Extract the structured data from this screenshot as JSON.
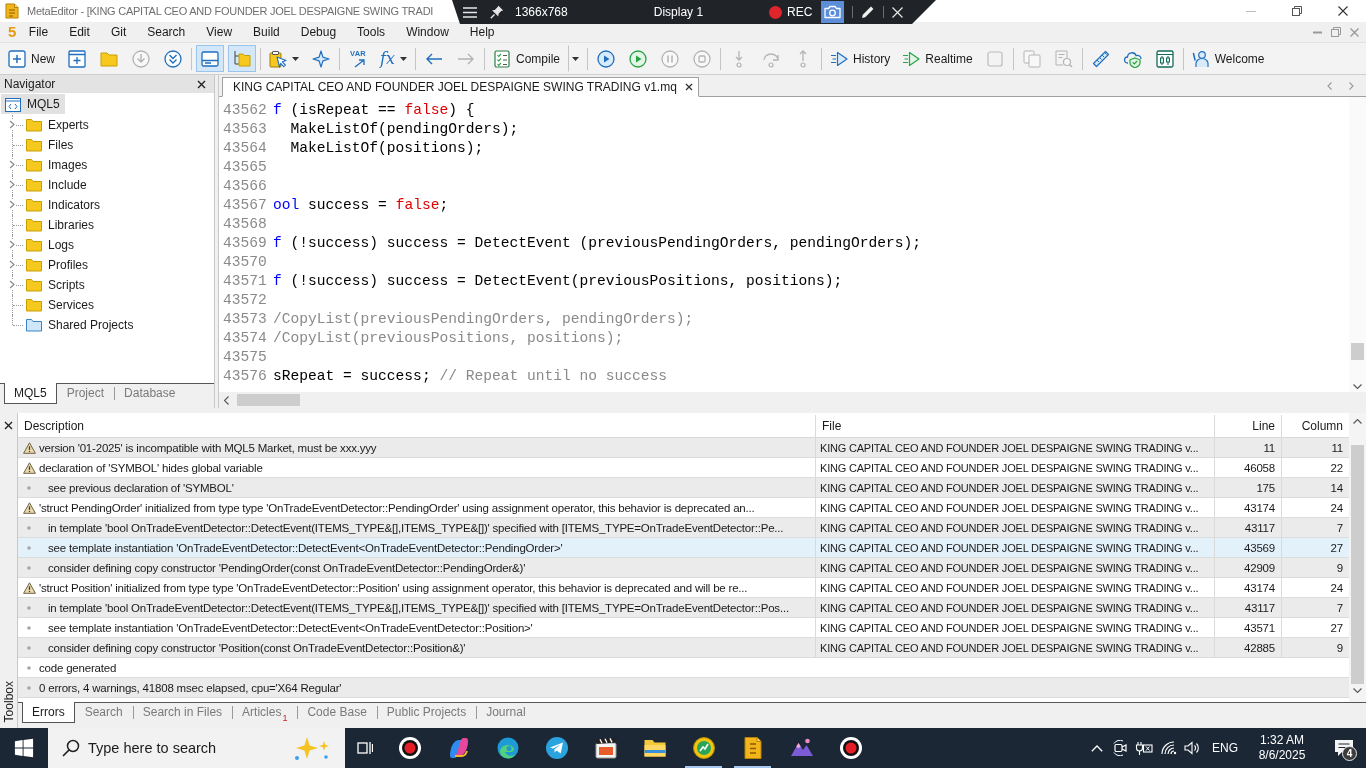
{
  "window": {
    "title": "MetaEditor - [KING CAPITAL CEO AND FOUNDER JOEL DESPAIGNE SWING TRADI"
  },
  "recorder": {
    "resolution": "1366x768",
    "display": "Display 1",
    "status": "REC",
    "camera": {
      "selected": true
    }
  },
  "menu": {
    "logo": "5",
    "items": [
      "File",
      "Edit",
      "Git",
      "Search",
      "View",
      "Build",
      "Debug",
      "Tools",
      "Window",
      "Help"
    ]
  },
  "toolbar": [
    {
      "kind": "icon",
      "label": "New",
      "disabled": false,
      "selected": false,
      "dropdown": false
    },
    {
      "kind": "icon",
      "disabled": false,
      "selected": false,
      "dropdown": false
    },
    {
      "kind": "icon",
      "disabled": false,
      "selected": false,
      "dropdown": false
    },
    {
      "kind": "icon",
      "disabled": true,
      "selected": false,
      "dropdown": false
    },
    {
      "kind": "icon",
      "disabled": false,
      "selected": false,
      "dropdown": false
    },
    {
      "kind": "separator"
    },
    {
      "kind": "icon",
      "disabled": false,
      "selected": true,
      "dropdown": false
    },
    {
      "kind": "icon",
      "disabled": false,
      "selected": true,
      "dropdown": false
    },
    {
      "kind": "separator"
    },
    {
      "kind": "icon",
      "disabled": false,
      "selected": false,
      "dropdown": true
    },
    {
      "kind": "icon",
      "disabled": false,
      "selected": false,
      "dropdown": false
    },
    {
      "kind": "separator"
    },
    {
      "kind": "tag",
      "label": "VAR",
      "disabled": false,
      "selected": false,
      "dropdown": false
    },
    {
      "kind": "formula",
      "label": "fx",
      "disabled": false,
      "selected": false,
      "dropdown": true
    },
    {
      "kind": "separator"
    },
    {
      "kind": "icon",
      "disabled": false,
      "selected": false,
      "dropdown": false
    },
    {
      "kind": "icon",
      "disabled": true,
      "selected": false,
      "dropdown": false
    },
    {
      "kind": "separator"
    },
    {
      "kind": "icon",
      "label": "Compile",
      "disabled": false,
      "selected": false,
      "dropdown": false
    },
    {
      "kind": "caret",
      "disabled": false,
      "selected": false
    },
    {
      "kind": "separator"
    },
    {
      "kind": "icon",
      "disabled": false,
      "selected": false,
      "dropdown": false
    },
    {
      "kind": "icon",
      "disabled": false,
      "selected": false,
      "dropdown": false
    },
    {
      "kind": "icon",
      "disabled": true,
      "selected": false,
      "dropdown": false
    },
    {
      "kind": "icon",
      "disabled": true,
      "selected": false,
      "dropdown": false
    },
    {
      "kind": "separator"
    },
    {
      "kind": "icon",
      "disabled": true,
      "selected": false,
      "dropdown": false
    },
    {
      "kind": "icon",
      "disabled": true,
      "selected": false,
      "dropdown": false
    },
    {
      "kind": "icon",
      "disabled": true,
      "selected": false,
      "dropdown": false
    },
    {
      "kind": "separator"
    },
    {
      "kind": "icon",
      "label": "History",
      "disabled": false,
      "selected": false,
      "dropdown": false
    },
    {
      "kind": "icon",
      "label": "Realtime",
      "disabled": false,
      "selected": false,
      "dropdown": false
    },
    {
      "kind": "icon",
      "disabled": true,
      "selected": false,
      "dropdown": false
    },
    {
      "kind": "separator"
    },
    {
      "kind": "icon",
      "disabled": true,
      "selected": false,
      "dropdown": false
    },
    {
      "kind": "icon",
      "disabled": true,
      "selected": false,
      "dropdown": false
    },
    {
      "kind": "separator"
    },
    {
      "kind": "icon",
      "disabled": false,
      "selected": false,
      "dropdown": false
    },
    {
      "kind": "icon",
      "disabled": false,
      "selected": false,
      "dropdown": false
    },
    {
      "kind": "icon",
      "disabled": false,
      "selected": false,
      "dropdown": false
    },
    {
      "kind": "separator"
    },
    {
      "kind": "icon",
      "label": "Welcome",
      "disabled": false,
      "selected": false,
      "dropdown": false
    }
  ],
  "navigator": {
    "title": "Navigator",
    "tree": {
      "label": "MQL5",
      "selected": true,
      "children": [
        {
          "label": "Experts",
          "kind": "folder",
          "expandable": true,
          "selected": false
        },
        {
          "label": "Files",
          "kind": "folder",
          "expandable": false,
          "selected": false
        },
        {
          "label": "Images",
          "kind": "folder",
          "expandable": true,
          "selected": false
        },
        {
          "label": "Include",
          "kind": "folder",
          "expandable": true,
          "selected": false
        },
        {
          "label": "Indicators",
          "kind": "folder",
          "expandable": true,
          "selected": false
        },
        {
          "label": "Libraries",
          "kind": "folder",
          "expandable": false,
          "selected": false
        },
        {
          "label": "Logs",
          "kind": "folder",
          "expandable": true,
          "selected": false
        },
        {
          "label": "Profiles",
          "kind": "folder",
          "expandable": true,
          "selected": false
        },
        {
          "label": "Scripts",
          "kind": "folder",
          "expandable": true,
          "selected": false
        },
        {
          "label": "Services",
          "kind": "folder",
          "expandable": false,
          "selected": false
        },
        {
          "label": "Shared Projects",
          "kind": "shared",
          "expandable": false,
          "selected": false
        }
      ]
    },
    "tabs": [
      {
        "label": "MQL5",
        "selected": true
      },
      {
        "label": "Project",
        "selected": false
      },
      {
        "label": "Database",
        "selected": false
      }
    ]
  },
  "editor": {
    "tabs": [
      {
        "label": "KING CAPITAL CEO AND FOUNDER JOEL DESPAIGNE SWING TRADING v1.mq",
        "selected": true
      }
    ],
    "lines": [
      {
        "number": "43562",
        "tokens": [
          {
            "kind": "keyword",
            "text": "f"
          },
          {
            "kind": "plain",
            "text": " (isRepeat == "
          },
          {
            "kind": "constant",
            "text": "false"
          },
          {
            "kind": "plain",
            "text": ") {"
          }
        ]
      },
      {
        "number": "43563",
        "tokens": [
          {
            "kind": "plain",
            "text": "  MakeListOf(pendingOrders);"
          }
        ]
      },
      {
        "number": "43564",
        "tokens": [
          {
            "kind": "plain",
            "text": "  MakeListOf(positions);"
          }
        ]
      },
      {
        "number": "43565"
      },
      {
        "number": "43566"
      },
      {
        "number": "43567",
        "tokens": [
          {
            "kind": "keyword",
            "text": "ool"
          },
          {
            "kind": "plain",
            "text": " success = "
          },
          {
            "kind": "constant",
            "text": "false"
          },
          {
            "kind": "plain",
            "text": ";"
          }
        ]
      },
      {
        "number": "43568"
      },
      {
        "number": "43569",
        "tokens": [
          {
            "kind": "keyword",
            "text": "f"
          },
          {
            "kind": "plain",
            "text": " (!success) success = DetectEvent (previousPendingOrders, pendingOrders);"
          }
        ]
      },
      {
        "number": "43570"
      },
      {
        "number": "43571",
        "tokens": [
          {
            "kind": "keyword",
            "text": "f"
          },
          {
            "kind": "plain",
            "text": " (!success) success = DetectEvent(previousPositions, positions);"
          }
        ]
      },
      {
        "number": "43572"
      },
      {
        "number": "43573",
        "tokens": [
          {
            "kind": "comment",
            "text": "/CopyList(previousPendingOrders, pendingOrders);"
          }
        ]
      },
      {
        "number": "43574",
        "tokens": [
          {
            "kind": "comment",
            "text": "/CopyList(previousPositions, positions);"
          }
        ]
      },
      {
        "number": "43575"
      },
      {
        "number": "43576",
        "tokens": [
          {
            "kind": "plain",
            "text": "sRepeat = success; "
          },
          {
            "kind": "comment",
            "text": "// Repeat until no success"
          }
        ]
      }
    ]
  },
  "toolbox": {
    "title": "Toolbox",
    "columns": [
      "Description",
      "File",
      "Line",
      "Column"
    ],
    "rows": [
      {
        "kind": "warning",
        "description": "version '01-2025' is incompatible with MQL5 Market, must be xxx.yyy",
        "file": "KING CAPITAL CEO AND FOUNDER JOEL DESPAIGNE SWING TRADING v...",
        "line": "11",
        "column": "11",
        "selected": false
      },
      {
        "kind": "warning",
        "description": "declaration of 'SYMBOL' hides global variable",
        "file": "KING CAPITAL CEO AND FOUNDER JOEL DESPAIGNE SWING TRADING v...",
        "line": "46058",
        "column": "22",
        "selected": false
      },
      {
        "kind": "note",
        "description": "see previous declaration of 'SYMBOL'",
        "file": "KING CAPITAL CEO AND FOUNDER JOEL DESPAIGNE SWING TRADING v...",
        "line": "175",
        "column": "14",
        "selected": false
      },
      {
        "kind": "warning",
        "description": "'struct PendingOrder' initialized from type type 'OnTradeEventDetector::PendingOrder' using assignment operator, this behavior is deprecated an...",
        "file": "KING CAPITAL CEO AND FOUNDER JOEL DESPAIGNE SWING TRADING v...",
        "line": "43174",
        "column": "24",
        "selected": false
      },
      {
        "kind": "note",
        "description": "in template 'bool OnTradeEventDetector::DetectEvent(ITEMS_TYPE&[],ITEMS_TYPE&[])' specified with [ITEMS_TYPE=OnTradeEventDetector::Pe...",
        "file": "KING CAPITAL CEO AND FOUNDER JOEL DESPAIGNE SWING TRADING v...",
        "line": "43117",
        "column": "7",
        "selected": false
      },
      {
        "kind": "note",
        "description": "see template instantiation 'OnTradeEventDetector::DetectEvent<OnTradeEventDetector::PendingOrder>'",
        "file": "KING CAPITAL CEO AND FOUNDER JOEL DESPAIGNE SWING TRADING v...",
        "line": "43569",
        "column": "27",
        "selected": true
      },
      {
        "kind": "note",
        "description": "consider defining copy constructor 'PendingOrder(const OnTradeEventDetector::PendingOrder&)'",
        "file": "KING CAPITAL CEO AND FOUNDER JOEL DESPAIGNE SWING TRADING v...",
        "line": "42909",
        "column": "9",
        "selected": false
      },
      {
        "kind": "warning",
        "description": "'struct Position' initialized from type type 'OnTradeEventDetector::Position' using assignment operator, this behavior is deprecated and will be re...",
        "file": "KING CAPITAL CEO AND FOUNDER JOEL DESPAIGNE SWING TRADING v...",
        "line": "43174",
        "column": "24",
        "selected": false
      },
      {
        "kind": "note",
        "description": "in template 'bool OnTradeEventDetector::DetectEvent(ITEMS_TYPE&[],ITEMS_TYPE&[])' specified with [ITEMS_TYPE=OnTradeEventDetector::Pos...",
        "file": "KING CAPITAL CEO AND FOUNDER JOEL DESPAIGNE SWING TRADING v...",
        "line": "43117",
        "column": "7",
        "selected": false
      },
      {
        "kind": "note",
        "description": "see template instantiation 'OnTradeEventDetector::DetectEvent<OnTradeEventDetector::Position>'",
        "file": "KING CAPITAL CEO AND FOUNDER JOEL DESPAIGNE SWING TRADING v...",
        "line": "43571",
        "column": "27",
        "selected": false
      },
      {
        "kind": "note",
        "description": "consider defining copy constructor 'Position(const OnTradeEventDetector::Position&)'",
        "file": "KING CAPITAL CEO AND FOUNDER JOEL DESPAIGNE SWING TRADING v...",
        "line": "42885",
        "column": "9",
        "selected": false
      },
      {
        "kind": "info",
        "description": "code generated",
        "selected": false
      },
      {
        "kind": "info",
        "description": "0 errors, 4 warnings, 41808 msec elapsed, cpu='X64 Regular'",
        "selected": false
      }
    ],
    "tabs": [
      {
        "label": "Errors",
        "selected": true
      },
      {
        "label": "Search",
        "selected": false
      },
      {
        "label": "Search in Files",
        "selected": false
      },
      {
        "label": "Articles",
        "badge": "1",
        "selected": false
      },
      {
        "label": "Code Base",
        "selected": false
      },
      {
        "label": "Public Projects",
        "selected": false
      },
      {
        "label": "Journal",
        "selected": false
      }
    ]
  },
  "taskbar": {
    "search": {
      "placeholder": "Type here to search"
    },
    "apps": [
      {
        "running": false
      },
      {
        "running": false
      },
      {
        "running": false
      },
      {
        "running": false
      },
      {
        "running": false
      },
      {
        "running": false
      },
      {
        "running": true
      },
      {
        "running": true
      },
      {
        "running": false
      },
      {
        "running": false
      }
    ],
    "language": "ENG",
    "time": "1:32 AM",
    "date": "8/6/2025",
    "notifications": "4"
  }
}
